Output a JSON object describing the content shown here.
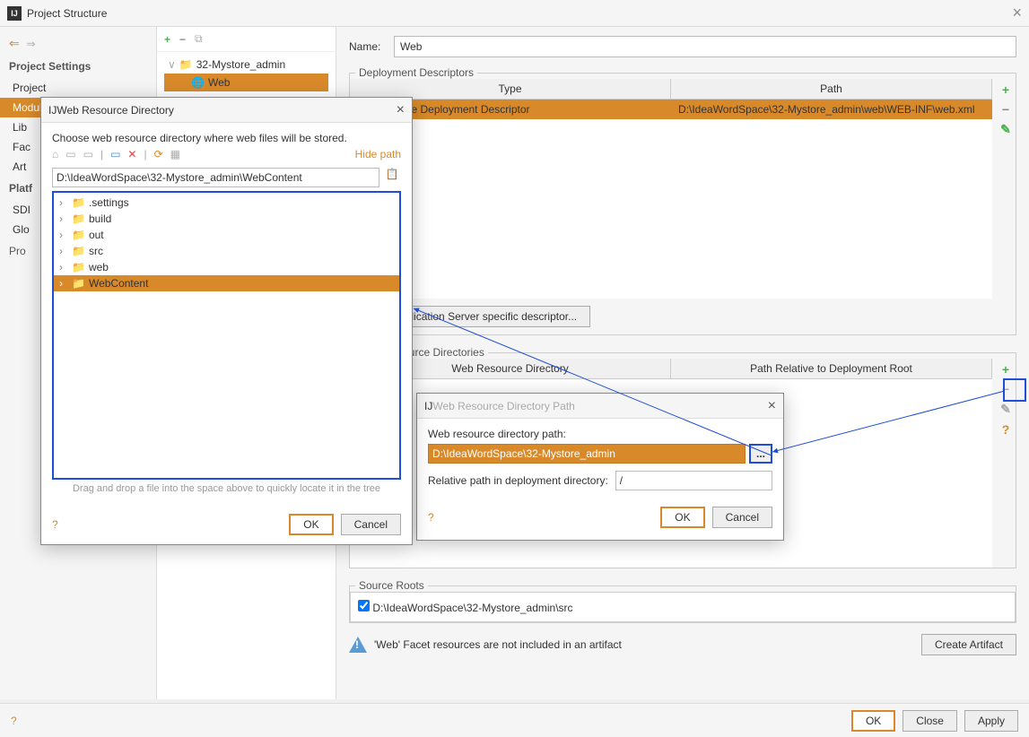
{
  "window": {
    "title": "Project Structure"
  },
  "sidebar": {
    "section1": "Project Settings",
    "items1": [
      "Project",
      "Modules",
      "Libraries",
      "Facets",
      "Artifacts"
    ],
    "section2": "Platform Settings",
    "items2": [
      "SDKs",
      "Global Libraries"
    ],
    "section3": "Problems"
  },
  "tree": {
    "root": "32-Mystore_admin",
    "child": "Web"
  },
  "form": {
    "name_label": "Name:",
    "name_value": "Web"
  },
  "deploy": {
    "legend": "Deployment Descriptors",
    "col1": "Type",
    "col2": "Path",
    "row_type": "Web Module Deployment Descriptor",
    "row_path": "D:\\IdeaWordSpace\\32-Mystore_admin\\web\\WEB-INF\\web.xml",
    "add_btn": "Add Application Server specific descriptor..."
  },
  "webres": {
    "legend": "Web Resource Directories",
    "col1": "Web Resource Directory",
    "col2": "Path Relative to Deployment Root"
  },
  "roots": {
    "legend": "Source Roots",
    "item": "D:\\IdeaWordSpace\\32-Mystore_admin\\src"
  },
  "hint": "'Web' Facet resources are not included in an artifact",
  "create_btn": "Create Artifact",
  "footer": {
    "ok": "OK",
    "close": "Close",
    "apply": "Apply"
  },
  "dlg1": {
    "title": "Web Resource Directory",
    "msg": "Choose web resource directory where web files will be stored.",
    "hide": "Hide path",
    "path": "D:\\IdeaWordSpace\\32-Mystore_admin\\WebContent",
    "folders": [
      ".settings",
      "build",
      "out",
      "src",
      "web",
      "WebContent"
    ],
    "hint": "Drag and drop a file into the space above to quickly locate it in the tree",
    "ok": "OK",
    "cancel": "Cancel"
  },
  "dlg2": {
    "title": "Web Resource Directory Path",
    "l1": "Web resource directory path:",
    "v1": "D:\\IdeaWordSpace\\32-Mystore_admin",
    "l2": "Relative path in deployment directory:",
    "v2": "/",
    "ok": "OK",
    "cancel": "Cancel"
  }
}
